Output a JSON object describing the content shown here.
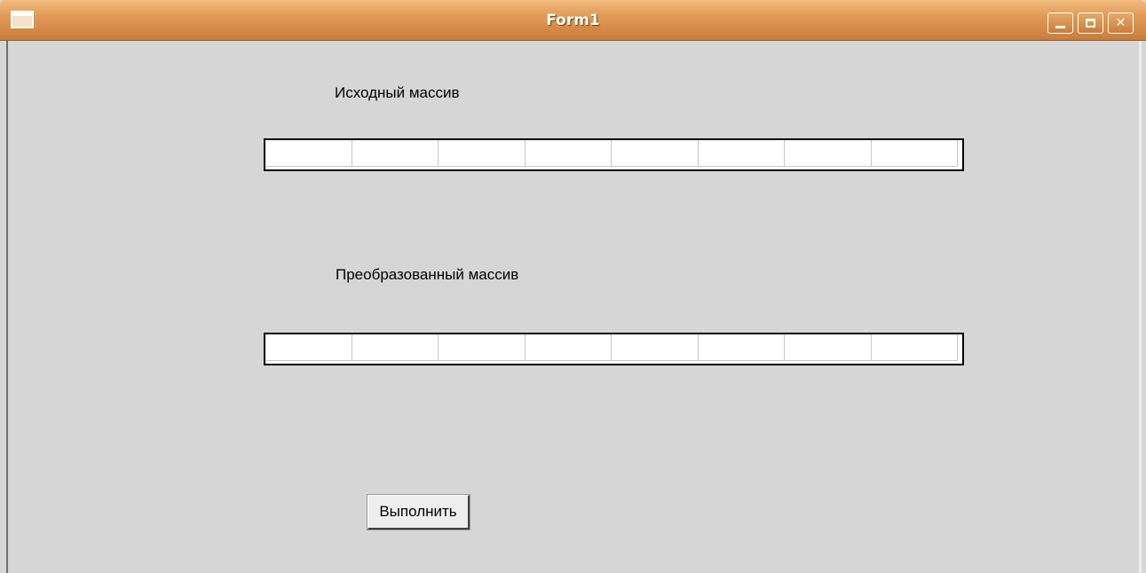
{
  "window": {
    "title": "Form1",
    "controls": {
      "minimize": "minimize-icon",
      "maximize": "maximize-icon",
      "close": "close-icon"
    }
  },
  "source_array": {
    "label": "Исходный массив",
    "cells": [
      "",
      "",
      "",
      "",
      "",
      "",
      "",
      ""
    ]
  },
  "result_array": {
    "label": "Преобразованный массив",
    "cells": [
      "",
      "",
      "",
      "",
      "",
      "",
      "",
      ""
    ]
  },
  "actions": {
    "run_label": "Выполнить"
  },
  "colors": {
    "titlebar_accent": "#e19a55",
    "form_background": "#d6d6d6"
  }
}
